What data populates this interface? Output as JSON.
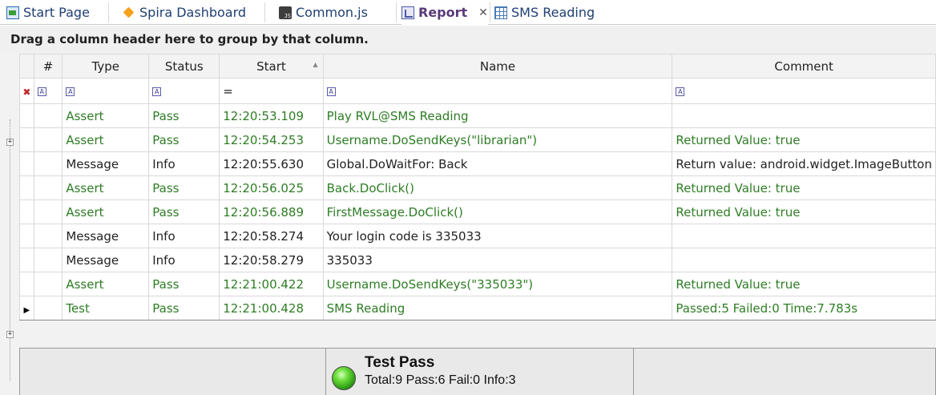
{
  "tabs": [
    {
      "label": "Start Page",
      "icon": "start-page-icon"
    },
    {
      "label": "Spira Dashboard",
      "icon": "spira-icon"
    },
    {
      "label": "Common.js",
      "icon": "js-file-icon"
    },
    {
      "label": "Report",
      "icon": "report-icon",
      "active": true,
      "close": "✕"
    },
    {
      "label": "SMS Reading",
      "icon": "grid-icon"
    }
  ],
  "group_hint": "Drag a column header here to group by that column.",
  "columns": {
    "num": "#",
    "type": "Type",
    "status": "Status",
    "start": "Start",
    "name": "Name",
    "comment": "Comment"
  },
  "filter": {
    "pin": "✖",
    "num": "A",
    "type": "A",
    "status": "A",
    "start": "=",
    "name": "A",
    "comment": "A"
  },
  "rows": [
    {
      "type": "Assert",
      "status": "Pass",
      "start": "12:20:53.109",
      "name": "Play RVL@SMS Reading",
      "comment": "",
      "tone": "green",
      "expander": "+"
    },
    {
      "type": "Assert",
      "status": "Pass",
      "start": "12:20:54.253",
      "name": "Username.DoSendKeys(\"librarian\")",
      "comment": "Returned Value: true",
      "tone": "green"
    },
    {
      "type": "Message",
      "status": "Info",
      "start": "12:20:55.630",
      "name": "Global.DoWaitFor: Back",
      "comment": "Return value: android.widget.ImageButton",
      "tone": "black"
    },
    {
      "type": "Assert",
      "status": "Pass",
      "start": "12:20:56.025",
      "name": "Back.DoClick()",
      "comment": "Returned Value: true",
      "tone": "green"
    },
    {
      "type": "Assert",
      "status": "Pass",
      "start": "12:20:56.889",
      "name": "FirstMessage.DoClick()",
      "comment": "Returned Value: true",
      "tone": "green"
    },
    {
      "type": "Message",
      "status": "Info",
      "start": "12:20:58.274",
      "name": "Your login code is 335033",
      "comment": "",
      "tone": "black"
    },
    {
      "type": "Message",
      "status": "Info",
      "start": "12:20:58.279",
      "name": "335033",
      "comment": "",
      "tone": "black"
    },
    {
      "type": "Assert",
      "status": "Pass",
      "start": "12:21:00.422",
      "name": "Username.DoSendKeys(\"335033\")",
      "comment": "Returned Value: true",
      "tone": "green"
    },
    {
      "type": "Test",
      "status": "Pass",
      "start": "12:21:00.428",
      "name": "SMS Reading",
      "comment": "Passed:5 Failed:0 Time:7.783s",
      "tone": "green",
      "current": true,
      "expander": "+"
    }
  ],
  "summary": {
    "title": "Test Pass",
    "detail": "Total:9 Pass:6 Fail:0 Info:3",
    "status_color": "#2a9a14"
  }
}
